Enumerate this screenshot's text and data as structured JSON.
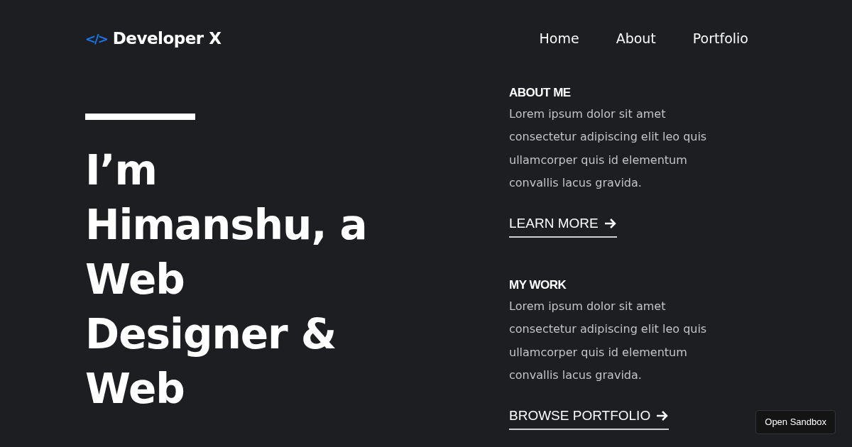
{
  "header": {
    "logo_icon": "</>",
    "logo_text": "Developer X",
    "nav": [
      {
        "label": "Home"
      },
      {
        "label": "About"
      },
      {
        "label": "Portfolio"
      }
    ]
  },
  "hero": {
    "heading": "I’m Himanshu, a Web Designer & Web"
  },
  "sections": [
    {
      "title": "ABOUT ME",
      "body": "Lorem ipsum dolor sit amet consectetur adipiscing elit leo quis ullamcorper quis id elementum convallis lacus gravida.",
      "link": "LEARN MORE"
    },
    {
      "title": "MY WORK",
      "body": "Lorem ipsum dolor sit amet consectetur adipiscing elit leo quis ullamcorper quis id elementum convallis lacus gravida.",
      "link": "BROWSE PORTFOLIO"
    }
  ],
  "sandbox_button": "Open Sandbox"
}
